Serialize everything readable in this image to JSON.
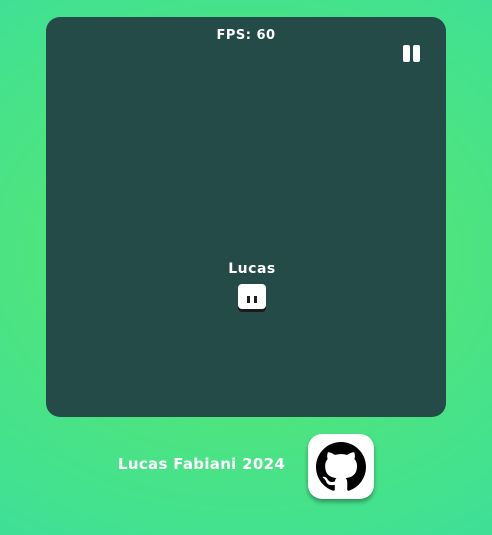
{
  "hud": {
    "fps_text": "FPS: 60"
  },
  "player": {
    "name": "Lucas"
  },
  "footer": {
    "credit": "Lucas Fabiani 2024"
  },
  "icons": {
    "pause": "pause-icon",
    "github": "github-icon"
  },
  "colors": {
    "panel_background": "#254b48",
    "page_gradient_start": "#5ae86c",
    "page_gradient_end": "#3fe096",
    "text": "#ffffff",
    "player_body": "#ffffff"
  }
}
